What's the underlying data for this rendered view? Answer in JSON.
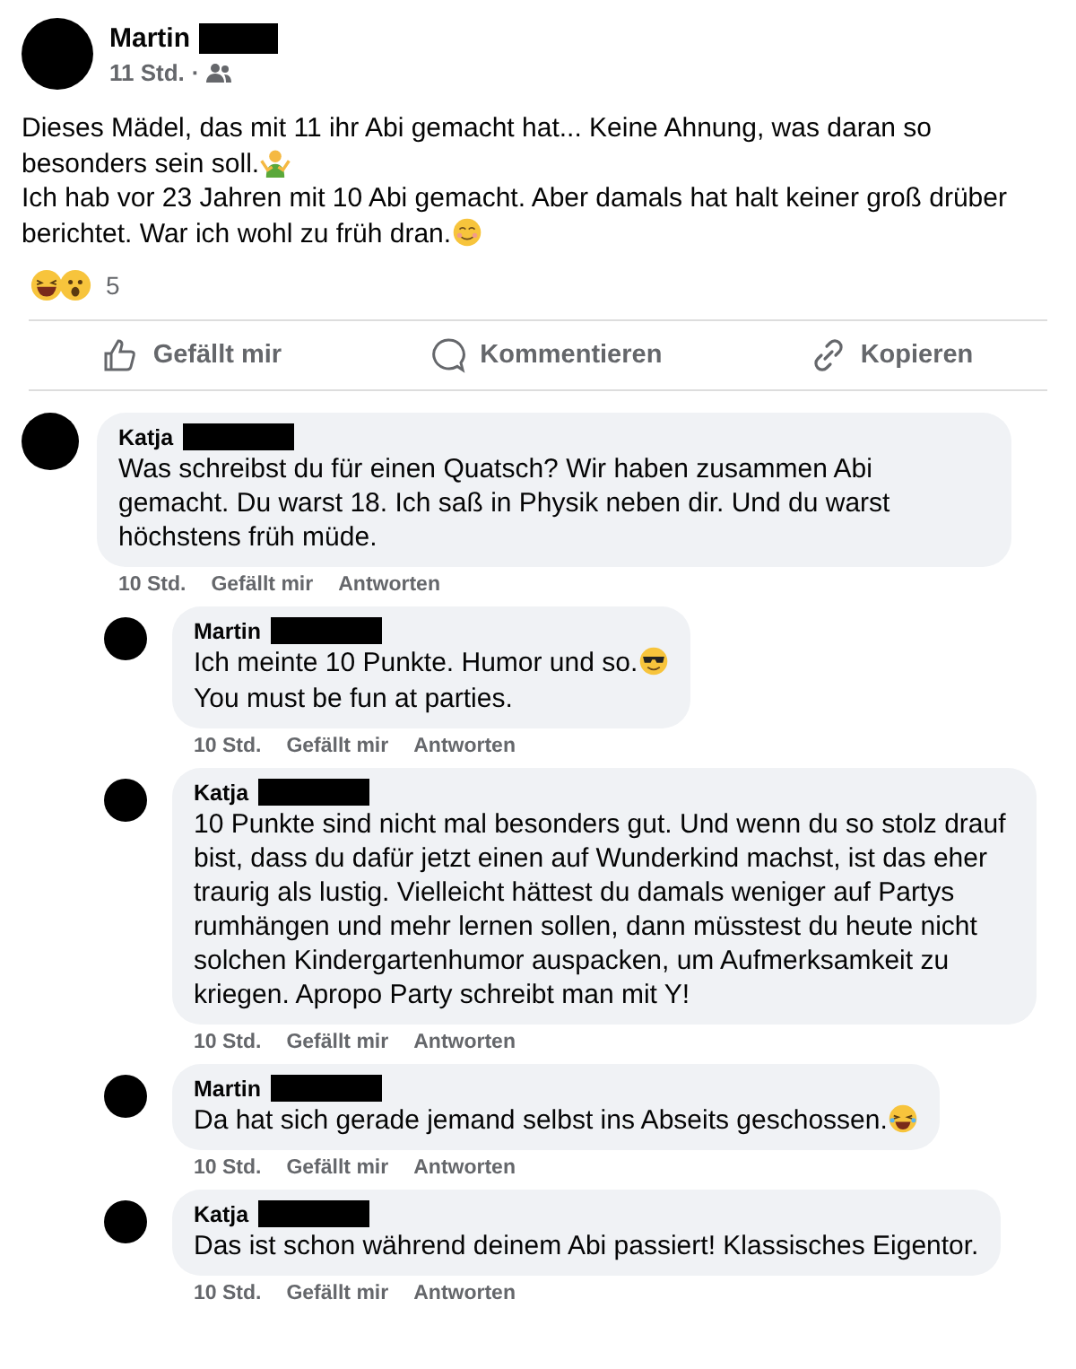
{
  "post": {
    "author": {
      "name": "Martin",
      "surname_redacted": true
    },
    "time": "11 Std.",
    "separator": "·",
    "audience": {
      "kind": "friends"
    },
    "paragraphs": [
      {
        "text": "Dieses Mädel, das mit 11 ihr Abi gemacht hat... Keine Ahnung, was daran so besonders sein soll.",
        "emoji": {
          "kind": "shrug"
        }
      },
      {
        "text": "Ich hab vor 23 Jahren mit 10 Abi gemacht. Aber damals hat halt keiner groß drüber berichtet. War ich wohl zu früh dran.",
        "emoji": {
          "kind": "relieved"
        }
      }
    ],
    "reactions": {
      "emojis": [
        {
          "kind": "laugh"
        },
        {
          "kind": "wow"
        }
      ],
      "count": "5"
    },
    "actions": [
      {
        "kind": "like",
        "label": "Gefällt mir"
      },
      {
        "kind": "comment",
        "label": "Kommentieren"
      },
      {
        "kind": "copy",
        "label": "Kopieren"
      }
    ]
  },
  "comments": [
    {
      "author": "Katja",
      "surname_redacted": true,
      "lines": [
        {
          "text": "Was schreibst du für einen Quatsch? Wir haben zusammen Abi gemacht. Du warst 18. Ich saß in Physik neben dir. Und du warst höchstens früh müde."
        }
      ],
      "time": "10 Std.",
      "like": "Gefällt mir",
      "reply": "Antworten",
      "replies": [
        {
          "author": "Martin",
          "surname_redacted": true,
          "lines": [
            {
              "text": "Ich meinte 10 Punkte. Humor und so.",
              "emoji": {
                "kind": "cool"
              }
            },
            {
              "text": "You must be fun at parties."
            }
          ],
          "time": "10 Std.",
          "like": "Gefällt mir",
          "reply": "Antworten"
        },
        {
          "author": "Katja",
          "surname_redacted": true,
          "lines": [
            {
              "text": "10 Punkte sind nicht mal besonders gut. Und wenn du so stolz drauf bist, dass du dafür jetzt einen auf Wunderkind machst, ist das eher traurig als lustig. Vielleicht hättest du damals weniger auf Partys rumhängen und mehr lernen sollen, dann müsstest du heute nicht solchen Kindergartenhumor auspacken, um Aufmerksamkeit zu kriegen. Apropo Party schreibt man mit Y!"
            }
          ],
          "time": "10 Std.",
          "like": "Gefällt mir",
          "reply": "Antworten"
        },
        {
          "author": "Martin",
          "surname_redacted": true,
          "lines": [
            {
              "text": "Da hat sich gerade jemand selbst ins Abseits geschossen.",
              "emoji": {
                "kind": "tears"
              }
            }
          ],
          "time": "10 Std.",
          "like": "Gefällt mir",
          "reply": "Antworten"
        },
        {
          "author": "Katja",
          "surname_redacted": true,
          "lines": [
            {
              "text": "Das ist schon während deinem Abi passiert! Klassisches Eigentor."
            }
          ],
          "time": "10 Std.",
          "like": "Gefällt mir",
          "reply": "Antworten"
        }
      ]
    }
  ]
}
